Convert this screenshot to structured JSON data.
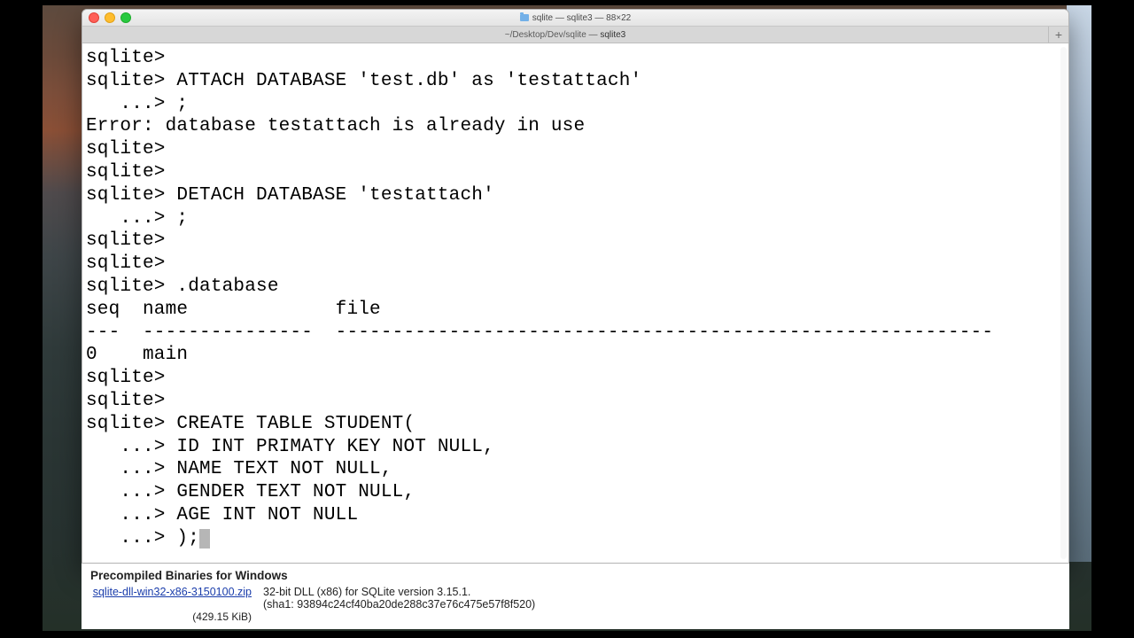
{
  "window": {
    "title_folder": "sqlite",
    "title_rest": " — sqlite3 — 88×22"
  },
  "tab": {
    "path": "~/Desktop/Dev/sqlite — ",
    "procname": "sqlite3"
  },
  "terminal": {
    "lines": [
      "sqlite>",
      "sqlite> ATTACH DATABASE 'test.db' as 'testattach'",
      "   ...> ;",
      "Error: database testattach is already in use",
      "sqlite>",
      "sqlite>",
      "sqlite> DETACH DATABASE 'testattach'",
      "   ...> ;",
      "sqlite>",
      "sqlite>",
      "sqlite> .database",
      "seq  name             file                                                      ",
      "---  ---------------  ----------------------------------------------------------",
      "0    main                                                                       ",
      "sqlite>",
      "sqlite>",
      "sqlite> CREATE TABLE STUDENT(",
      "   ...> ID INT PRIMATY KEY NOT NULL,",
      "   ...> NAME TEXT NOT NULL,",
      "   ...> GENDER TEXT NOT NULL,",
      "   ...> AGE INT NOT NULL",
      "   ...> );"
    ]
  },
  "browser": {
    "heading": "Precompiled Binaries for Windows",
    "link": "sqlite-dll-win32-x86-3150100.zip",
    "desc": "32-bit DLL (x86) for SQLite version 3.15.1.",
    "sha": "(sha1: 93894c24cf40ba20de288c37e76c475e57f8f520)",
    "size": "(429.15 KiB)"
  }
}
